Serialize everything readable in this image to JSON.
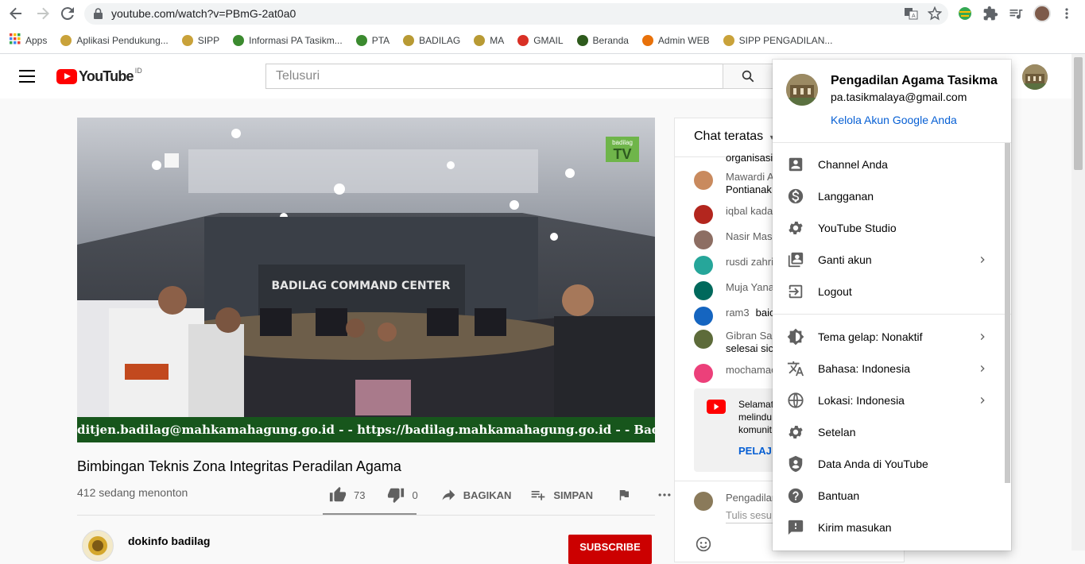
{
  "browser": {
    "url": "youtube.com/watch?v=PBmG-2at0a0",
    "bookmarks": [
      {
        "label": "Apps",
        "color": "#4285f4"
      },
      {
        "label": "Aplikasi Pendukung...",
        "color": "#c9a23a"
      },
      {
        "label": "SIPP",
        "color": "#c9a23a"
      },
      {
        "label": "Informasi PA Tasikm...",
        "color": "#3b8a2f"
      },
      {
        "label": "PTA",
        "color": "#3b8a2f"
      },
      {
        "label": "BADILAG",
        "color": "#b89a34"
      },
      {
        "label": "MA",
        "color": "#b89a34"
      },
      {
        "label": "GMAIL",
        "color": "#d93025"
      },
      {
        "label": "Beranda",
        "color": "#2e5a1c"
      },
      {
        "label": "Admin WEB",
        "color": "#e8710a"
      },
      {
        "label": "SIPP PENGADILAN...",
        "color": "#c9a23a"
      }
    ]
  },
  "header": {
    "logo_text": "YouTube",
    "region": "ID",
    "search_placeholder": "Telusuri"
  },
  "video": {
    "overlay_title": "BADILAG COMMAND CENTER",
    "ticker": "ditjen.badilag@mahkamahagung.go.id - - https://badilag.mahkamahagung.go.id - - Badilag... Excellence",
    "badge": "TV",
    "badge_top": "badilag",
    "title": "Bimbingan Teknis Zona Integritas Peradilan Agama",
    "viewers": "412 sedang menonton",
    "likes": "73",
    "dislikes": "0",
    "share_label": "BAGIKAN",
    "save_label": "SIMPAN",
    "channel_name": "dokinfo badilag",
    "subscribe_label": "SUBSCRIBE"
  },
  "chat": {
    "header": "Chat teratas",
    "messages": [
      {
        "author": "",
        "text": "organisasi",
        "color": "#ffffff"
      },
      {
        "author": "Mawardi A",
        "text": "Pontianak",
        "color": "#c98a5e"
      },
      {
        "author": "iqbal kada",
        "text": "",
        "color": "#b3261e"
      },
      {
        "author": "Nasir Mas",
        "text": "",
        "color": "#8d6e63"
      },
      {
        "author": "rusdi zahri",
        "text": "",
        "color": "#26a69a"
      },
      {
        "author": "Muja Yana",
        "text": "",
        "color": "#00695c"
      },
      {
        "author": "ram3",
        "text": "baic",
        "color": "#1565c0"
      },
      {
        "author": "Gibran Sas",
        "text": "selesai sic",
        "color": "#5d6b3a"
      },
      {
        "author": "mochamac",
        "text": "",
        "color": "#ec407a"
      }
    ],
    "notice_text_1": "Selamat",
    "notice_text_2": "melindu",
    "notice_text_3": "komunit",
    "notice_link": "PELAJ",
    "input_author": "Pengadilan",
    "input_placeholder": "Tulis sesu"
  },
  "account_menu": {
    "name": "Pengadilan Agama Tasikmalaya",
    "email": "pa.tasikmalaya@gmail.com",
    "manage_label": "Kelola Akun Google Anda",
    "section1": [
      {
        "label": "Channel Anda",
        "icon": "person-box-icon"
      },
      {
        "label": "Langganan",
        "icon": "dollar-icon"
      },
      {
        "label": "YouTube Studio",
        "icon": "gear-icon"
      },
      {
        "label": "Ganti akun",
        "icon": "switch-account-icon",
        "chevron": true
      },
      {
        "label": "Logout",
        "icon": "logout-icon"
      }
    ],
    "section2": [
      {
        "label": "Tema gelap: Nonaktif",
        "icon": "theme-icon",
        "chevron": true
      },
      {
        "label": "Bahasa: Indonesia",
        "icon": "translate-icon",
        "chevron": true
      },
      {
        "label": "Lokasi: Indonesia",
        "icon": "globe-icon",
        "chevron": true
      },
      {
        "label": "Setelan",
        "icon": "gear-icon"
      },
      {
        "label": "Data Anda di YouTube",
        "icon": "shield-person-icon"
      },
      {
        "label": "Bantuan",
        "icon": "help-icon"
      },
      {
        "label": "Kirim masukan",
        "icon": "feedback-icon"
      }
    ]
  }
}
